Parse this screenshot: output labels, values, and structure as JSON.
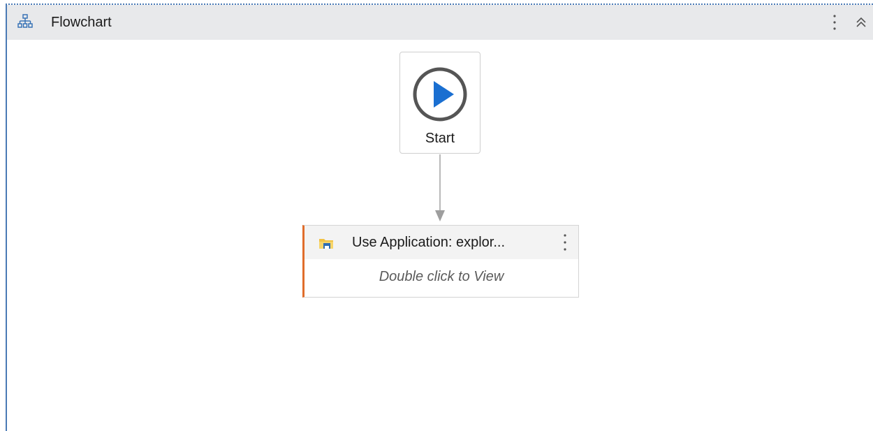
{
  "panel": {
    "title": "Flowchart",
    "icon": "flowchart-icon",
    "accent_color": "#4a7ab5"
  },
  "start_node": {
    "label": "Start",
    "icon": "play-icon",
    "icon_color": "#1a6fd1"
  },
  "activity_node": {
    "title": "Use Application: explor...",
    "hint": "Double click to View",
    "icon": "application-window-icon",
    "accent_color": "#e06d2b"
  }
}
